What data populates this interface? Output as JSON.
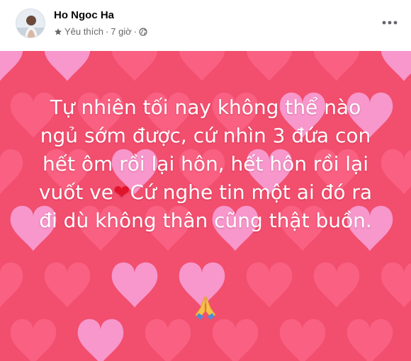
{
  "post": {
    "author": "Ho Ngoc Ha",
    "meta": {
      "favorite_label": "Yêu thích",
      "separator": "·",
      "time": "7 giờ",
      "audience_icon": "globe-icon"
    },
    "more_icon": "more-options-icon",
    "message": {
      "part1": "Tự nhiên tối nay không thể nào ngủ sớm được, cứ nhìn 3 đứa con hết ôm rồi lại hôn, hết hôn rồi lại vuốt ve",
      "heart": "❤",
      "part2": "Cứ nghe tin một ai đó ra đi dù không thân cũng thật buồn.",
      "closing_icon": "folded-hands-icon"
    }
  },
  "colors": {
    "background": "#f24e6e",
    "heart_pink": "#ff6f93",
    "heart_light": "#f7a0d6",
    "text": "#ffffff",
    "secondary_text": "#65676b",
    "heart_red": "#e0142a"
  }
}
